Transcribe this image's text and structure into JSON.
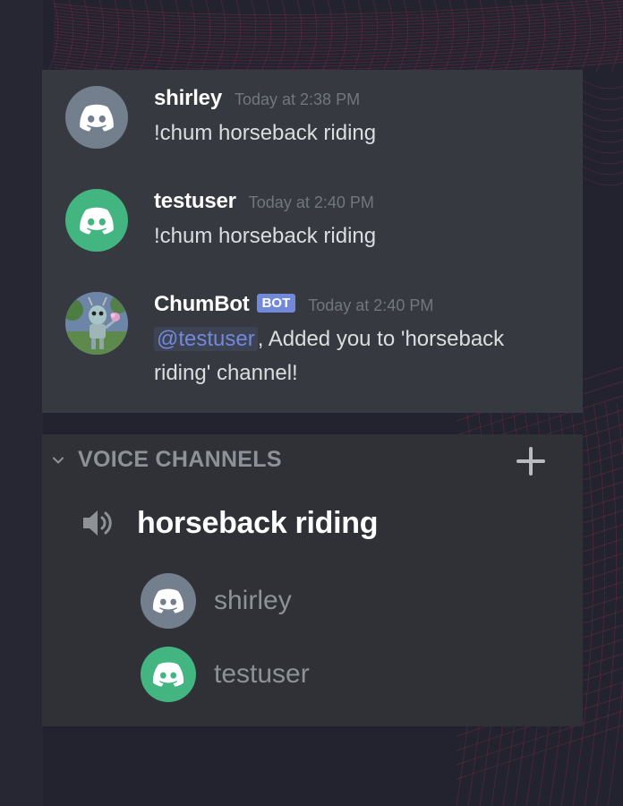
{
  "colors": {
    "page_bg": "#23232f",
    "chat_bg": "#36393f",
    "voice_bg": "#2f3136",
    "avatar_grey": "#747f8d",
    "avatar_green": "#43b581",
    "blurple": "#7289da",
    "mesh": "#b8345c"
  },
  "messages": [
    {
      "author": "shirley",
      "timestamp": "Today at 2:38 PM",
      "text": "!chum horseback riding",
      "avatar_icon": "discord-logo-icon",
      "avatar_color": "#747f8d"
    },
    {
      "author": "testuser",
      "timestamp": "Today at 2:40 PM",
      "text": "!chum horseback riding",
      "avatar_icon": "discord-logo-icon",
      "avatar_color": "#43b581"
    },
    {
      "author": "ChumBot",
      "bot_tag": "BOT",
      "timestamp": "Today at 2:40 PM",
      "mention": "@testuser",
      "text": ", Added you to 'horseback riding' channel!",
      "avatar_icon": "robot-illustration-icon"
    }
  ],
  "voice": {
    "section_label": "VOICE CHANNELS",
    "add_icon": "plus-icon",
    "collapse_icon": "chevron-down-icon",
    "channel": {
      "name": "horseback riding",
      "icon": "speaker-icon"
    },
    "users": [
      {
        "name": "shirley",
        "avatar_icon": "discord-logo-icon",
        "avatar_color": "#747f8d"
      },
      {
        "name": "testuser",
        "avatar_icon": "discord-logo-icon",
        "avatar_color": "#43b581"
      }
    ]
  }
}
